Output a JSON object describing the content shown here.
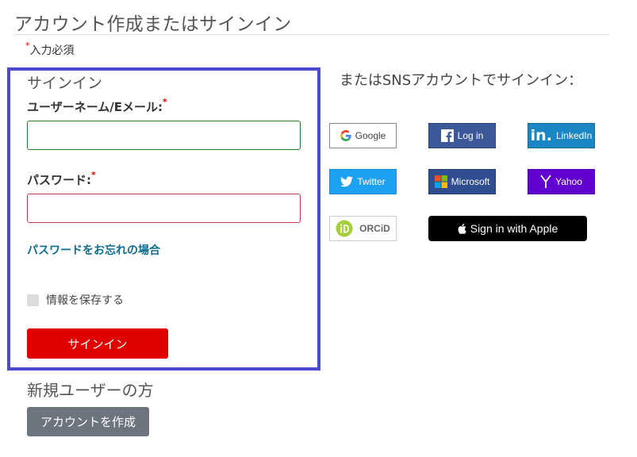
{
  "page": {
    "title": "アカウント作成またはサインイン",
    "required_note": "入力必須",
    "required_mark": "*"
  },
  "signin": {
    "title": "サインイン",
    "username_label": "ユーザーネーム/Eメール:",
    "username_value": "",
    "password_label": "パスワード:",
    "password_value": "",
    "forgot_link": "パスワードをお忘れの場合",
    "remember_label": "情報を保存する",
    "remember_checked": false,
    "submit_label": "サインイン"
  },
  "new_user": {
    "title": "新規ユーザーの方",
    "create_label": "アカウントを作成"
  },
  "sns": {
    "heading": "またはSNSアカウントでサインイン：",
    "buttons": {
      "google": "Google",
      "facebook": "Log in",
      "linkedin": "LinkedIn",
      "twitter": "Twitter",
      "microsoft": "Microsoft",
      "yahoo": "Yahoo",
      "orcid": "ORCiD",
      "apple": "Sign in with Apple"
    }
  },
  "colors": {
    "accent_red": "#e00000",
    "frame_blue": "#4b4bcf",
    "link_blue": "#106c8e",
    "secondary_gray": "#6c757d"
  }
}
